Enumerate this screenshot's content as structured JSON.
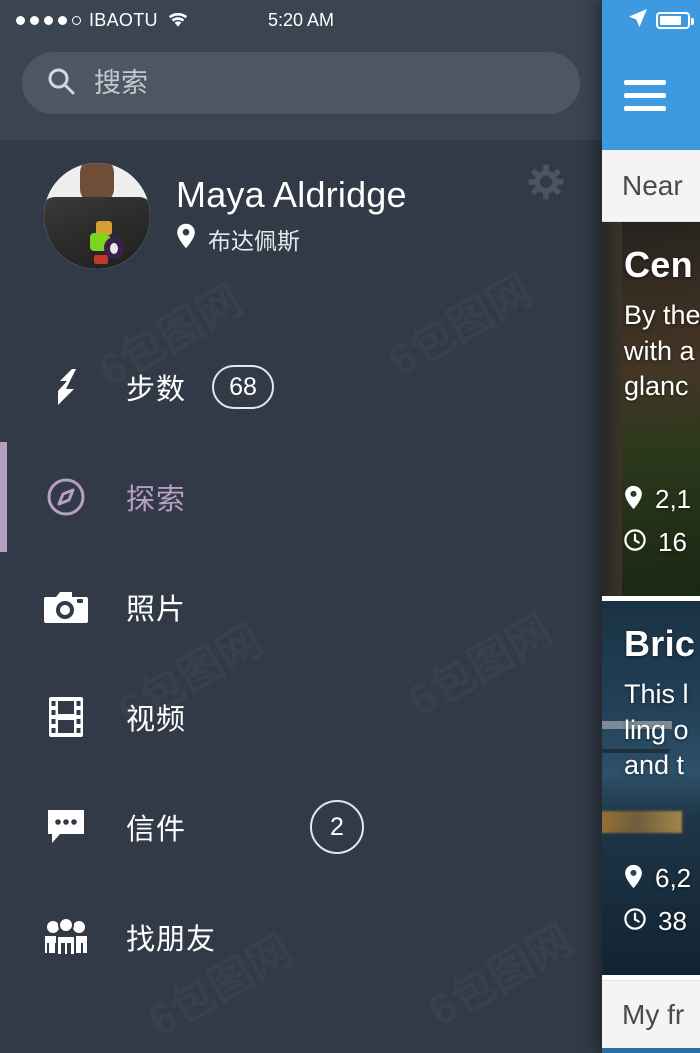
{
  "status_bar": {
    "signal_dots_filled": 4,
    "signal_dots_total": 5,
    "carrier": "IBAOTU",
    "wifi_icon": "wifi-icon",
    "time": "5:20 AM"
  },
  "search": {
    "icon": "search-icon",
    "placeholder": "搜索",
    "value": ""
  },
  "profile": {
    "avatar_icon": "avatar",
    "name": "Maya Aldridge",
    "location_icon": "location-pin-icon",
    "location": "布达佩斯",
    "settings_icon": "gear-icon"
  },
  "nav": {
    "items": [
      {
        "icon": "lightning-bolt-icon",
        "label": "步数",
        "badge": "68",
        "badge_shape": "pill",
        "active": false
      },
      {
        "icon": "compass-icon",
        "label": "探索",
        "badge": "",
        "badge_shape": "",
        "active": true
      },
      {
        "icon": "camera-icon",
        "label": "照片",
        "badge": "",
        "badge_shape": "",
        "active": false
      },
      {
        "icon": "film-icon",
        "label": "视频",
        "badge": "",
        "badge_shape": "",
        "active": false
      },
      {
        "icon": "chat-bubble-icon",
        "label": "信件",
        "badge": "2",
        "badge_shape": "circle",
        "active": false
      },
      {
        "icon": "people-group-icon",
        "label": "找朋友",
        "badge": "",
        "badge_shape": "",
        "active": false
      }
    ]
  },
  "peek_panel": {
    "status_bar": {
      "location_arrow_icon": "location-arrow-icon",
      "battery_icon": "battery-icon"
    },
    "header": {
      "menu_icon": "hamburger-menu-icon"
    },
    "tab_label": "Near",
    "bottom_label": "My fr",
    "cards": [
      {
        "image": "central-park-photo",
        "title": "Cen",
        "description": "By the\nwith a\nglanc",
        "distance_icon": "location-pin-icon",
        "distance": "2,1",
        "time_icon": "clock-icon",
        "time": "16"
      },
      {
        "image": "brooklyn-bridge-photo",
        "title": "Bric",
        "description": "This l\nling o\nand t",
        "distance_icon": "location-pin-icon",
        "distance": "6,2",
        "time_icon": "clock-icon",
        "time": "38"
      }
    ]
  },
  "colors": {
    "sidebar_bg": "#313a46",
    "statusbar_bg": "#3a4551",
    "search_bg": "#4c5763",
    "accent_purple": "#b79fc4",
    "peek_blue": "#3d9ae0",
    "text_white": "#ffffff"
  },
  "watermark": {
    "text": "6包图网"
  }
}
